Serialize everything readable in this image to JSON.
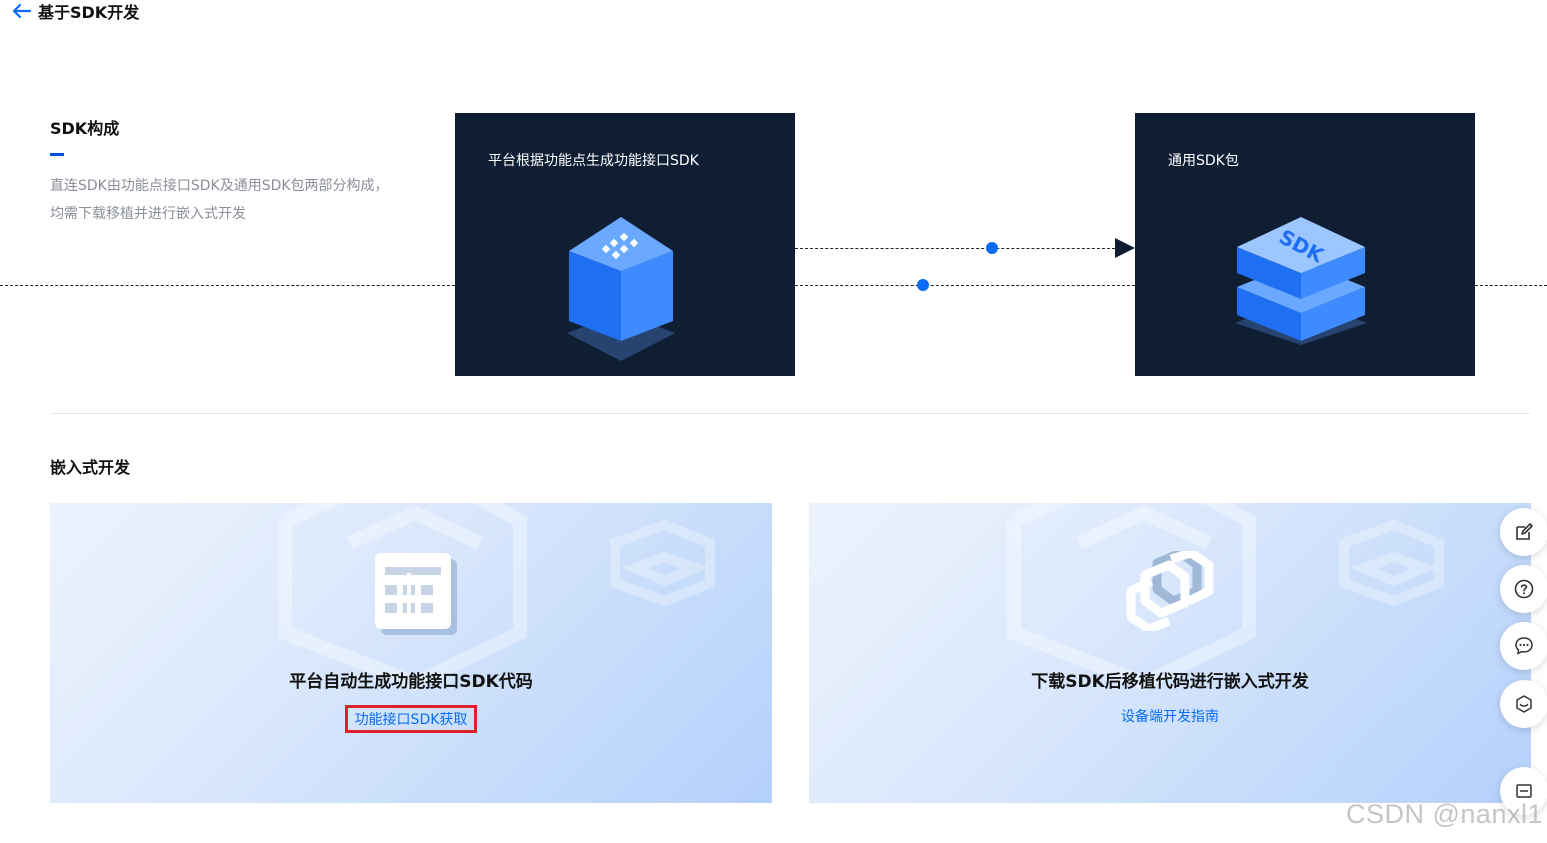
{
  "header": {
    "back_icon": "arrow-left-icon",
    "title": "基于SDK开发"
  },
  "sdk_structure": {
    "title": "SDK构成",
    "description": "直连SDK由功能点接口SDK及通用SDK包两部分构成，均需下载移植并进行嵌入式开发",
    "cards": [
      {
        "title": "平台根据功能点生成功能接口SDK",
        "icon": "blue-cube-icon"
      },
      {
        "title": "通用SDK包",
        "icon": "sdk-stack-icon"
      }
    ]
  },
  "embedded": {
    "title": "嵌入式开发",
    "cards": [
      {
        "title": "平台自动生成功能接口SDK代码",
        "link": "功能接口SDK获取",
        "icon": "grid-document-icon",
        "highlighted": true
      },
      {
        "title": "下载SDK后移植代码进行嵌入式开发",
        "link": "设备端开发指南",
        "icon": "link-chain-icon",
        "highlighted": false
      }
    ]
  },
  "floating_toolbar": [
    {
      "name": "edit-icon"
    },
    {
      "name": "help-icon"
    },
    {
      "name": "chat-icon"
    },
    {
      "name": "support-icon"
    },
    {
      "name": "collapse-icon"
    }
  ],
  "colors": {
    "accent": "#0a6cf5",
    "dark_card": "#0f1e33",
    "highlight_border": "#e0202b"
  },
  "watermark": "CSDN @nanxl1"
}
